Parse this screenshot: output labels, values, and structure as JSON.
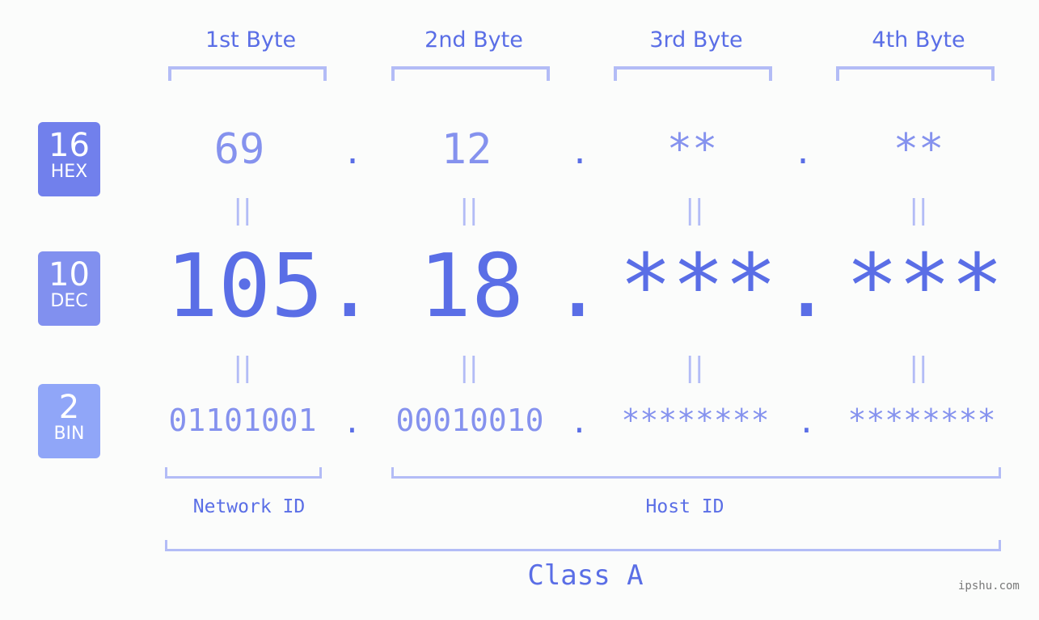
{
  "bytes": [
    {
      "header": "1st Byte",
      "hex": "69",
      "dec": "105",
      "bin": "01101001"
    },
    {
      "header": "2nd Byte",
      "hex": "12",
      "dec": "18",
      "bin": "00010010"
    },
    {
      "header": "3rd Byte",
      "hex": "**",
      "dec": "***",
      "bin": "********"
    },
    {
      "header": "4th Byte",
      "hex": "**",
      "dec": "***",
      "bin": "********"
    }
  ],
  "separator": ".",
  "equals": "||",
  "bases": {
    "hex": {
      "num": "16",
      "label": "HEX",
      "color": "#7180ec"
    },
    "dec": {
      "num": "10",
      "label": "DEC",
      "color": "#8190ef"
    },
    "bin": {
      "num": "2",
      "label": "BIN",
      "color": "#90a6f8"
    }
  },
  "network_id_label": "Network ID",
  "host_id_label": "Host ID",
  "class_label": "Class A",
  "watermark": "ipshu.com",
  "colors": {
    "accent": "#5a6ee6",
    "light": "#8592ee",
    "bracket": "#b3bcf6"
  }
}
